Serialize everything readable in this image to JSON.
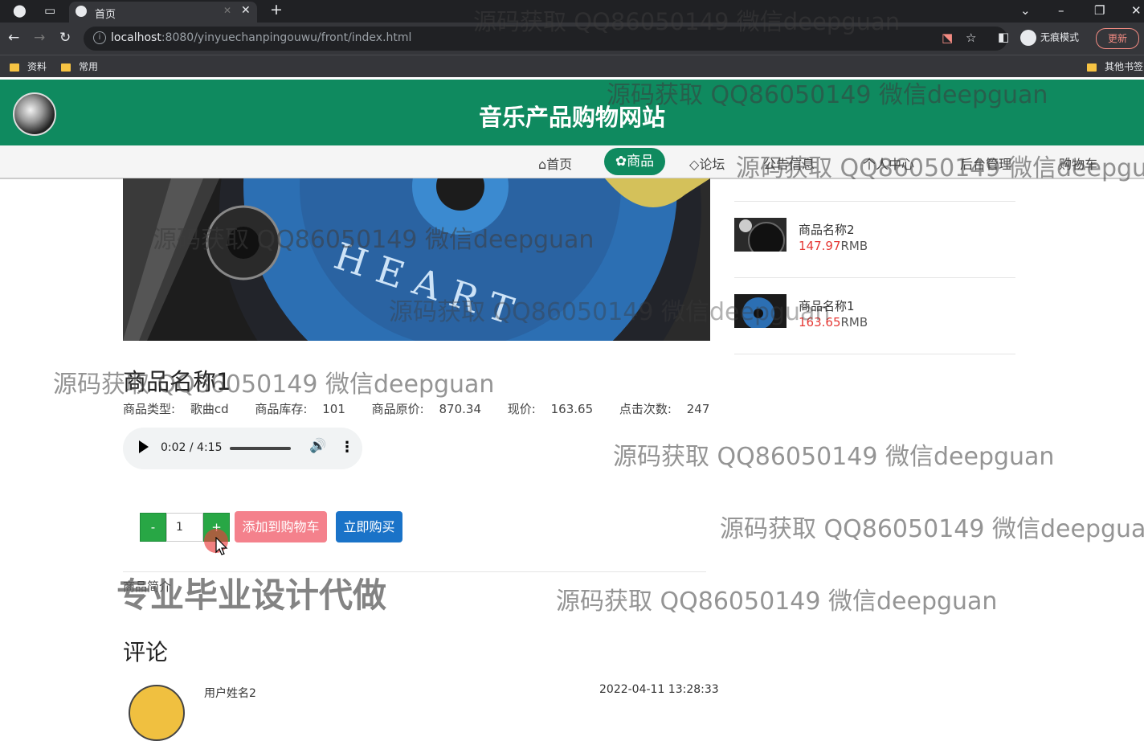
{
  "browser": {
    "tab_title": "首页",
    "url_host": "localhost",
    "url_rest": ":8080/yinyuechanpingouwu/front/index.html",
    "incognito_label": "无痕模式",
    "update_label": "更新",
    "bookmarks": [
      "资料",
      "常用"
    ],
    "other_bookmarks": "其他书签"
  },
  "site": {
    "title": "音乐产品购物网站",
    "nav": [
      "首页",
      "商品",
      "论坛",
      "公告信息",
      "个人中心",
      "后台管理",
      "购物车"
    ],
    "active_nav": "商品"
  },
  "recent_products": [
    {
      "name": "商品名称2",
      "price": "147.97",
      "unit": "RMB"
    },
    {
      "name": "商品名称1",
      "price": "163.65",
      "unit": "RMB"
    }
  ],
  "product": {
    "name": "商品名称1",
    "type_label": "商品类型:",
    "type_value": "歌曲cd",
    "stock_label": "商品库存:",
    "stock_value": "101",
    "orig_price_label": "商品原价:",
    "orig_price_value": "870.34",
    "price_label": "现价:",
    "price_value": "163.65",
    "clicks_label": "点击次数:",
    "clicks_value": "247",
    "audio_time": "0:02 / 4:15",
    "quantity": "1",
    "minus_label": "-",
    "plus_label": "+",
    "add_cart_label": "添加到购物车",
    "buy_now_label": "立即购买",
    "intro_label": "商品简介"
  },
  "comments": {
    "title": "评论",
    "items": [
      {
        "user": "用户姓名2",
        "time": "2022-04-11 13:28:33"
      }
    ]
  },
  "watermark": {
    "text": "源码获取 QQ86050149 微信deepguan",
    "big_text": "专业毕业设计代做"
  },
  "colors": {
    "header_green": "#0f8a5f",
    "add_cart_pink": "#f4818c",
    "buy_blue": "#1a73c8",
    "price_red": "#e53935"
  }
}
